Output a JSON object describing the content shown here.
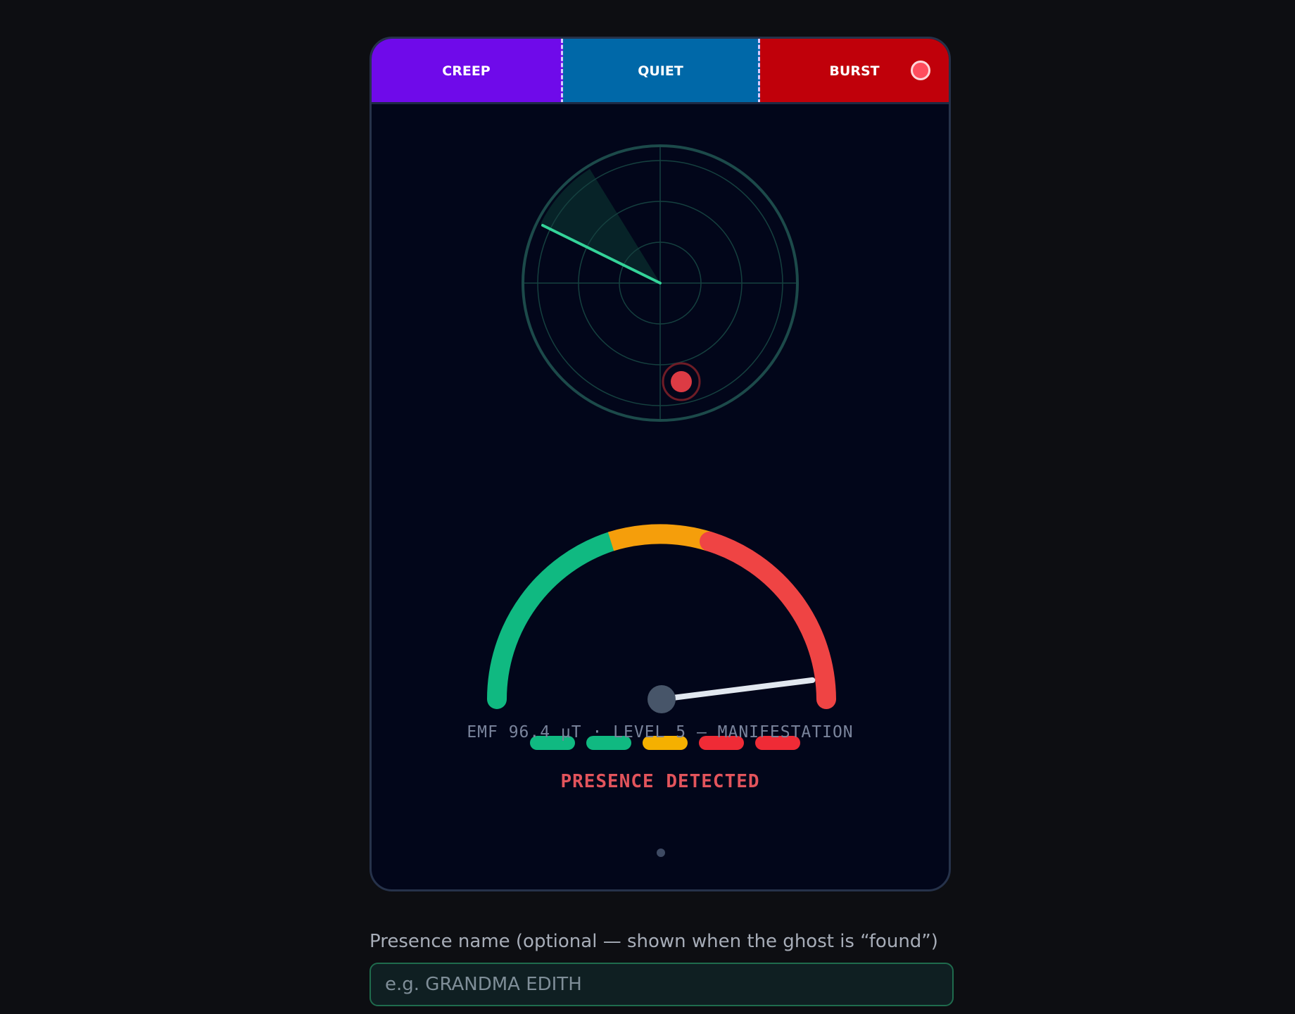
{
  "modes": [
    {
      "label": "CREEP",
      "color": "#6f0aea"
    },
    {
      "label": "QUIET",
      "color": "#0068a8"
    },
    {
      "label": "BURST",
      "color": "#c0000a"
    }
  ],
  "record_indicator": {
    "icon": "record-icon",
    "color": "#ff4d5e"
  },
  "radar": {
    "icon": "radar-scope",
    "sweep_color": "#34d399",
    "ring_color": "#1c4a4a",
    "blip_color": "#dc3b44"
  },
  "gauge": {
    "segment_colors": [
      "#10b981",
      "#f59e0b",
      "#ef4444"
    ],
    "needle_fraction": 0.96,
    "level_pills": [
      {
        "color": "#10b981"
      },
      {
        "color": "#10b981"
      },
      {
        "color": "#f5b000"
      },
      {
        "color": "#ef2b36"
      },
      {
        "color": "#ef2b36"
      }
    ]
  },
  "readout": "EMF 96.4 μT · LEVEL 5 — MANIFESTATION",
  "status": "PRESENCE DETECTED",
  "presence_field": {
    "label": "Presence name (optional — shown when the ghost is “found”)",
    "placeholder": "e.g. GRANDMA EDITH",
    "value": ""
  }
}
